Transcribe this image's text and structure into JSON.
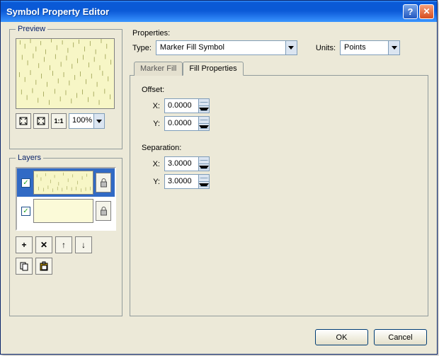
{
  "window": {
    "title": "Symbol Property Editor"
  },
  "preview": {
    "legend": "Preview",
    "zoom": "100%"
  },
  "layers": {
    "legend": "Layers",
    "items": [
      {
        "checked": true,
        "selected": true
      },
      {
        "checked": true,
        "selected": false
      }
    ]
  },
  "properties": {
    "label": "Properties:",
    "type_label": "Type:",
    "type_value": "Marker Fill Symbol",
    "units_label": "Units:",
    "units_value": "Points",
    "tabs": {
      "marker_fill": "Marker Fill",
      "fill_properties": "Fill Properties"
    },
    "offset": {
      "label": "Offset:",
      "x_label": "X:",
      "x_value": "0.0000",
      "y_label": "Y:",
      "y_value": "0.0000"
    },
    "separation": {
      "label": "Separation:",
      "x_label": "X:",
      "x_value": "3.0000",
      "y_label": "Y:",
      "y_value": "3.0000"
    }
  },
  "buttons": {
    "ok": "OK",
    "cancel": "Cancel"
  }
}
